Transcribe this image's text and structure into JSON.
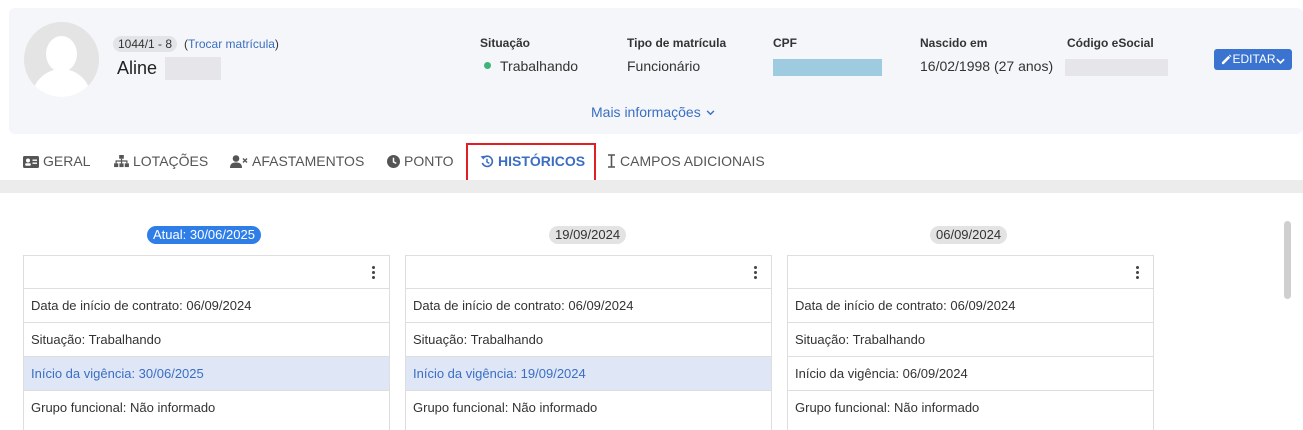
{
  "profile": {
    "matricula": "1044/1 - 8",
    "trocar_open": "(",
    "trocar_link": "Trocar matrícula",
    "trocar_close": ")",
    "name": "Aline"
  },
  "info": {
    "situacao_label": "Situação",
    "situacao_value": "Trabalhando",
    "situacao_color": "#3fb37a",
    "tipo_label": "Tipo de matrícula",
    "tipo_value": "Funcionário",
    "cpf_label": "CPF",
    "nascido_label": "Nascido em",
    "nascido_value": "16/02/1998 (27 anos)",
    "esocial_label": "Código eSocial"
  },
  "actions": {
    "editar_label": "EDITAR",
    "editar_icon": "pencil-icon",
    "mais_info_label": "Mais informações"
  },
  "tabs": [
    {
      "label": "GERAL",
      "icon": "id-card-icon"
    },
    {
      "label": "LOTAÇÕES",
      "icon": "sitemap-icon"
    },
    {
      "label": "AFASTAMENTOS",
      "icon": "user-x-icon"
    },
    {
      "label": "PONTO",
      "icon": "clock-icon"
    },
    {
      "label": "HISTÓRICOS",
      "icon": "history-icon",
      "active": true
    },
    {
      "label": "CAMPOS ADICIONAIS",
      "icon": "text-cursor-icon"
    }
  ],
  "colors": {
    "accent": "#3b6ec2",
    "highlight_border": "#e01e24",
    "current_badge": "#2f7ee8",
    "row_highlight": "#dfe7f7"
  },
  "history": [
    {
      "date_label": "Atual: 30/06/2025",
      "current": true,
      "rows": [
        "Data de início de contrato: 06/09/2024",
        "Situação: Trabalhando",
        "Início da vigência: 30/06/2025",
        "Grupo funcional: Não informado"
      ],
      "highlight_row": 2
    },
    {
      "date_label": "19/09/2024",
      "current": false,
      "rows": [
        "Data de início de contrato: 06/09/2024",
        "Situação: Trabalhando",
        "Início da vigência: 19/09/2024",
        "Grupo funcional: Não informado"
      ],
      "highlight_row": 2
    },
    {
      "date_label": "06/09/2024",
      "current": false,
      "rows": [
        "Data de início de contrato: 06/09/2024",
        "Situação: Trabalhando",
        "Início da vigência: 06/09/2024",
        "Grupo funcional: Não informado"
      ],
      "highlight_row": -1
    }
  ]
}
